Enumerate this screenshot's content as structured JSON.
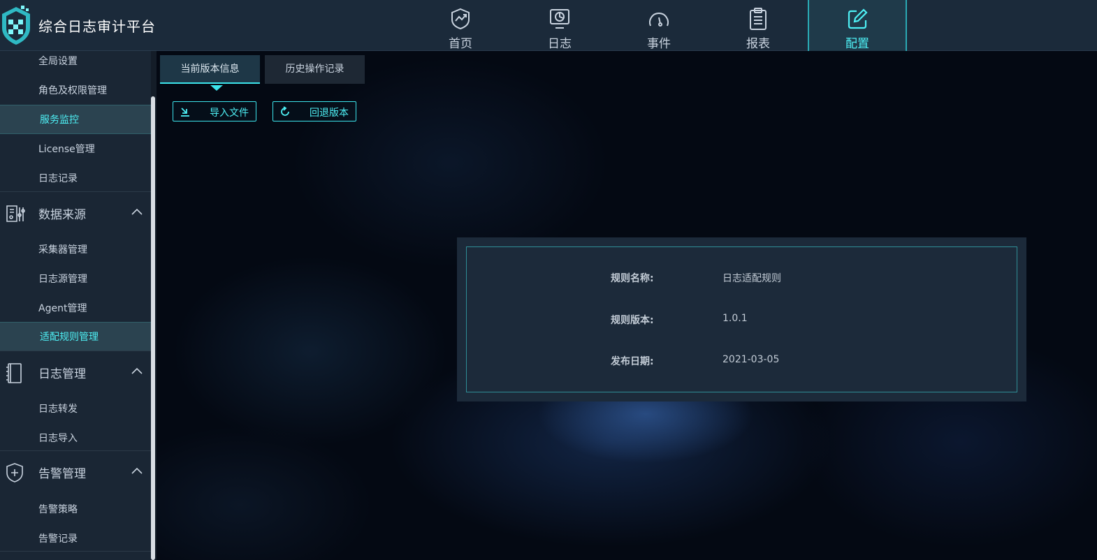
{
  "app": {
    "title": "综合日志审计平台"
  },
  "nav": [
    {
      "label": "首页",
      "icon": "home-chart-shield-icon",
      "active": false
    },
    {
      "label": "日志",
      "icon": "monitor-chart-icon",
      "active": false
    },
    {
      "label": "事件",
      "icon": "gauge-icon",
      "active": false
    },
    {
      "label": "报表",
      "icon": "clipboard-icon",
      "active": false
    },
    {
      "label": "配置",
      "icon": "edit-icon",
      "active": true
    }
  ],
  "sidebar": {
    "system_items": [
      {
        "label": "全局设置"
      },
      {
        "label": "角色及权限管理"
      },
      {
        "label": "服务监控",
        "active": true
      },
      {
        "label": "License管理"
      },
      {
        "label": "日志记录"
      }
    ],
    "groups": [
      {
        "label": "数据来源",
        "icon": "data-source-icon",
        "expanded": true,
        "items": [
          {
            "label": "采集器管理"
          },
          {
            "label": "日志源管理"
          },
          {
            "label": "Agent管理"
          },
          {
            "label": "适配规则管理",
            "active": true
          }
        ]
      },
      {
        "label": "日志管理",
        "icon": "notebook-icon",
        "expanded": true,
        "items": [
          {
            "label": "日志转发"
          },
          {
            "label": "日志导入"
          }
        ]
      },
      {
        "label": "告警管理",
        "icon": "shield-plus-icon",
        "expanded": true,
        "items": [
          {
            "label": "告警策略"
          },
          {
            "label": "告警记录"
          }
        ]
      }
    ]
  },
  "main": {
    "tabs": [
      {
        "label": "当前版本信息",
        "active": true
      },
      {
        "label": "历史操作记录",
        "active": false
      }
    ],
    "toolbar": {
      "import_label": "导入文件",
      "rollback_label": "回退版本"
    },
    "info": {
      "rule_name_label": "规则名称:",
      "rule_name_value": "日志适配规则",
      "rule_version_label": "规则版本:",
      "rule_version_value": "1.0.1",
      "release_date_label": "发布日期:",
      "release_date_value": "2021-03-05"
    }
  },
  "colors": {
    "accent": "#4ef0f5",
    "topbar": "#1b2a3a",
    "sidebar": "#1a2634",
    "background": "#040913"
  }
}
